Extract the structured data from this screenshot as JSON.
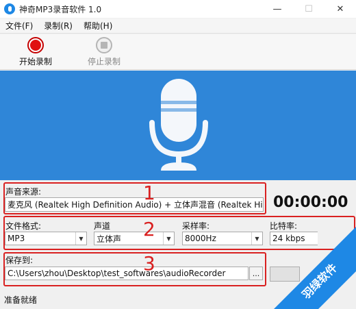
{
  "window": {
    "title": "神奇MP3录音软件 1.0",
    "min": "—",
    "max": "☐",
    "close": "✕"
  },
  "menu": {
    "file": "文件(F)",
    "record": "录制(R)",
    "help": "帮助(H)"
  },
  "toolbar": {
    "start_label": "开始录制",
    "stop_label": "停止录制"
  },
  "source": {
    "label": "声音来源:",
    "value": "麦克风 (Realtek High Definition Audio) + 立体声混音 (Realtek Hig ..."
  },
  "timer": "00:00:00",
  "format": {
    "label": "文件格式:",
    "value": "MP3"
  },
  "channel": {
    "label": "声道",
    "value": "立体声"
  },
  "samplerate": {
    "label": "采样率:",
    "value": "8000Hz"
  },
  "bitrate": {
    "label": "比特率:",
    "value": "24 kbps"
  },
  "save": {
    "label": "保存到:",
    "path": "C:\\Users\\zhou\\Desktop\\test_softwares\\audioRecorder",
    "browse": "..."
  },
  "status": "准备就绪",
  "annotations": {
    "n1": "1",
    "n2": "2",
    "n3": "3"
  },
  "watermark": "羽绿软件",
  "colors": {
    "banner": "#2f86d8",
    "annotation": "#d92020",
    "watermark": "#1e88e5"
  }
}
